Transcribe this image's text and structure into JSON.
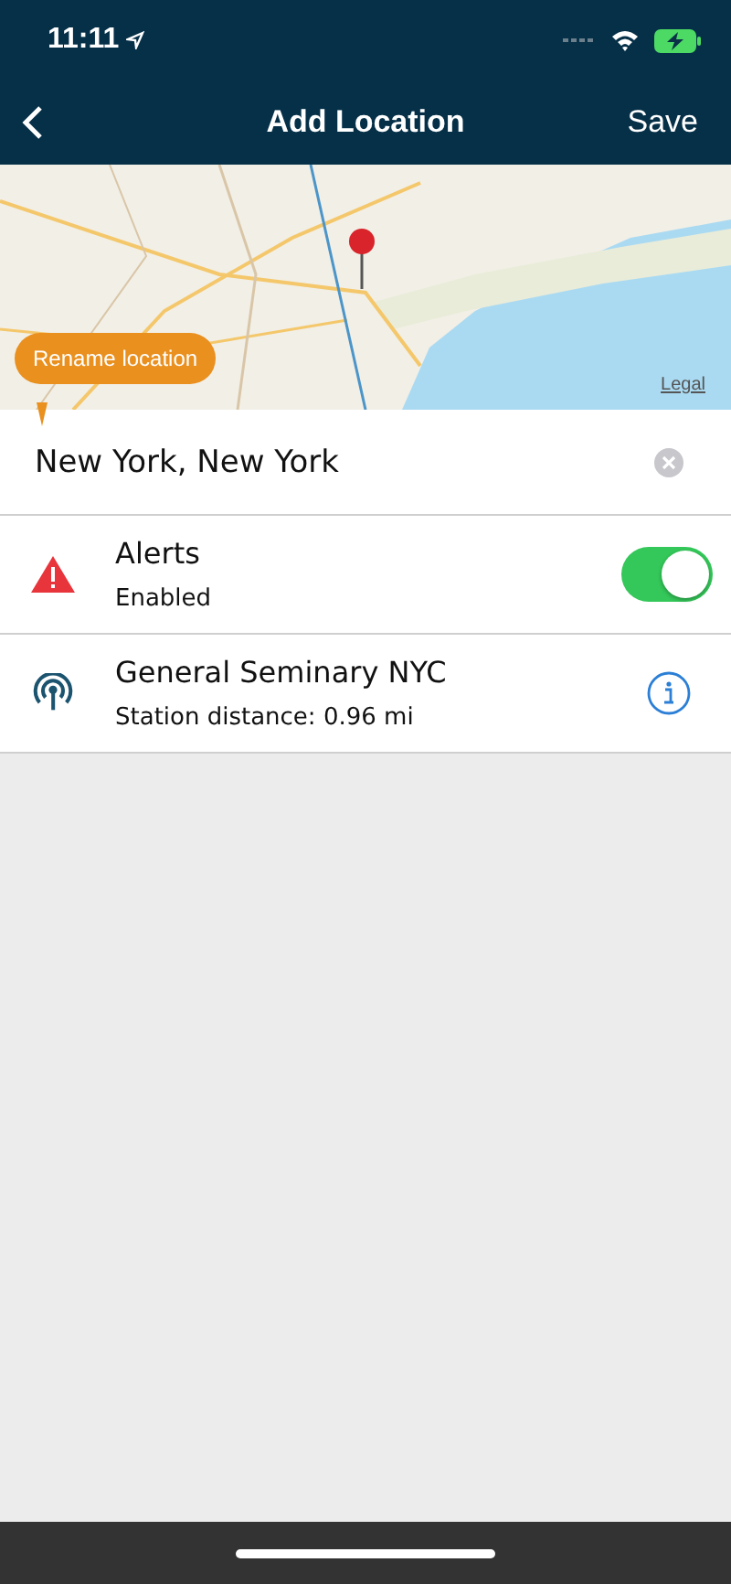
{
  "status_bar": {
    "time": "11:11"
  },
  "nav": {
    "title": "Add Location",
    "action": "Save"
  },
  "map": {
    "kind": "picture",
    "tooltip": "Rename location",
    "legal": "Legal"
  },
  "name_field": {
    "value": "New York, New York"
  },
  "rows": [
    {
      "kind": "toggle",
      "title": "Alerts",
      "subtitle": "Enabled",
      "on": true
    },
    {
      "kind": "info",
      "title": "General Seminary NYC",
      "subtitle": "Station distance: 0.96 mi"
    }
  ]
}
